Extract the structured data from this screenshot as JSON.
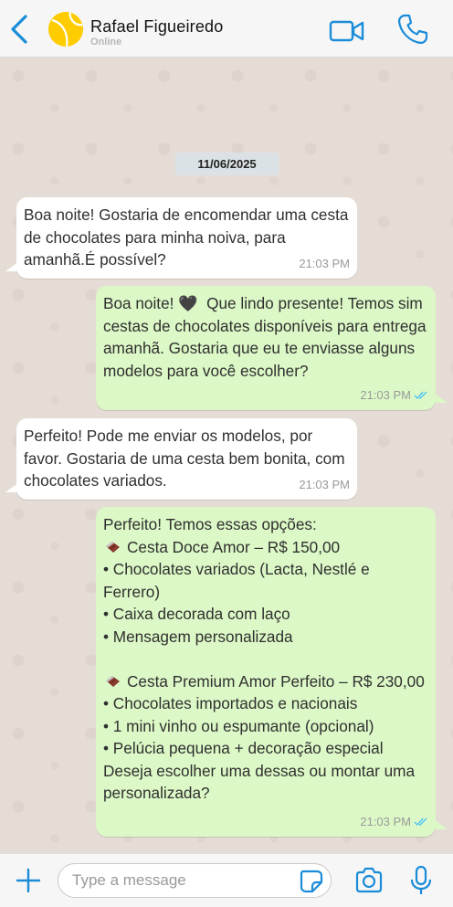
{
  "header": {
    "contact_name": "Rafael Figueiredo",
    "status": "Online",
    "accent_color": "#1a8cd8",
    "icons": [
      "back-arrow-icon",
      "avatar",
      "video-call-icon",
      "phone-call-icon"
    ]
  },
  "chat": {
    "date": "11/06/2025",
    "messages": [
      {
        "direction": "in",
        "text": "Boa noite! Gostaria de encomendar uma cesta de chocolates para minha noiva, para amanhã.É possível?",
        "time": "21:03 PM"
      },
      {
        "direction": "out",
        "text": "Boa noite! 🖤  Que lindo presente! Temos sim cestas de chocolates disponíveis para entrega amanhã. Gostaria que eu te enviasse alguns modelos para você escolher?",
        "time": "21:03 PM",
        "read": true
      },
      {
        "direction": "in",
        "text": "Perfeito! Pode me enviar os modelos, por favor. Gostaria de uma cesta bem bonita, com chocolates variados.",
        "time": "21:03 PM"
      },
      {
        "direction": "out",
        "intro": "Perfeito! Temos essas opções:",
        "option1_title": "Cesta Doce Amor – R$ 150,00",
        "option1_items": [
          "• Chocolates variados (Lacta, Nestlé e Ferrero)",
          "• Caixa decorada com laço",
          "• Mensagem personalizada"
        ],
        "option2_title": "Cesta Premium Amor Perfeito – R$ 230,00",
        "option2_items": [
          "• Chocolates importados e nacionais",
          "• 1 mini vinho ou espumante (opcional)",
          "• Pelúcia pequena + decoração especial"
        ],
        "closing": "Deseja escolher uma dessas ou montar uma personalizada?",
        "time": "21:03 PM",
        "read": true
      }
    ]
  },
  "composer": {
    "placeholder": "Type a message",
    "icons": [
      "plus-icon",
      "sticker-icon",
      "camera-icon",
      "microphone-icon"
    ]
  },
  "colors": {
    "incoming_bubble": "#ffffff",
    "outgoing_bubble": "#dcf8c6",
    "read_ticks": "#4fc3f7",
    "chat_background": "#e5ddd5"
  }
}
